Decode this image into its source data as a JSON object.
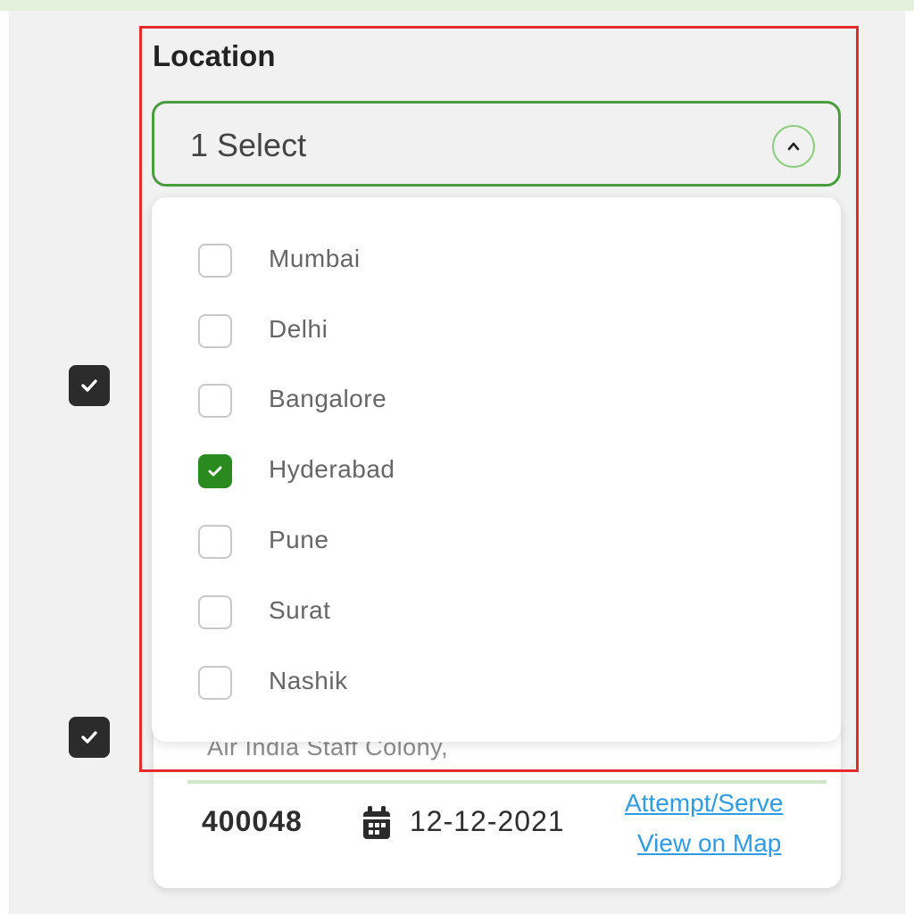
{
  "field": {
    "label": "Location",
    "selected_summary": "1 Select"
  },
  "options": [
    {
      "label": "Mumbai",
      "checked": false
    },
    {
      "label": "Delhi",
      "checked": false
    },
    {
      "label": "Bangalore",
      "checked": false
    },
    {
      "label": "Hyderabad",
      "checked": true
    },
    {
      "label": "Pune",
      "checked": false
    },
    {
      "label": "Surat",
      "checked": false
    },
    {
      "label": "Nashik",
      "checked": false
    }
  ],
  "card": {
    "address": "Air India Staff Colony,",
    "pincode": "400048",
    "date": "12-12-2021",
    "attempt_link": "Attempt/Serve",
    "map_link": "View on Map"
  },
  "colors": {
    "accent_green": "#4a9d3f",
    "checked_green": "#2b8a1f",
    "link_blue": "#2f9be2",
    "highlight_red": "#e52b2b"
  },
  "icons": {
    "calendar": "calendar-icon",
    "chevron": "chevron-up-icon",
    "check": "check-icon"
  }
}
